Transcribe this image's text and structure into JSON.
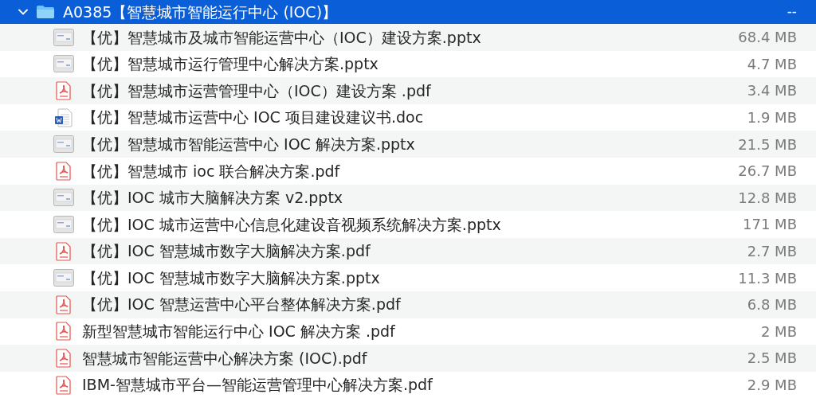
{
  "folder": {
    "name": "A0385【智慧城市智能运行中心 (IOC)】",
    "size": "--",
    "expanded": true,
    "selected": true
  },
  "files": [
    {
      "kind": "pptx",
      "name": "【优】智慧城市及城市智能运营中心（IOC）建设方案.pptx",
      "size": "68.4 MB",
      "selected": false
    },
    {
      "kind": "pptx",
      "name": "【优】智慧城市运行管理中心解决方案.pptx",
      "size": "4.7 MB",
      "selected": false
    },
    {
      "kind": "pdf",
      "name": "【优】智慧城市运营管理中心（IOC）建设方案 .pdf",
      "size": "3.4 MB",
      "selected": false
    },
    {
      "kind": "doc",
      "name": "【优】智慧城市运营中心 IOC 项目建设建议书.doc",
      "size": "1.9 MB",
      "selected": false
    },
    {
      "kind": "pptx",
      "name": "【优】智慧城市智能运营中心 IOC 解决方案.pptx",
      "size": "21.5 MB",
      "selected": false
    },
    {
      "kind": "pdf",
      "name": "【优】智慧城市 ioc 联合解决方案.pdf",
      "size": "26.7 MB",
      "selected": false
    },
    {
      "kind": "pptx",
      "name": "【优】IOC 城市大脑解决方案 v2.pptx",
      "size": "12.8 MB",
      "selected": false
    },
    {
      "kind": "pptx",
      "name": "【优】IOC 城市运营中心信息化建设音视频系统解决方案.pptx",
      "size": "171 MB",
      "selected": false
    },
    {
      "kind": "pdf",
      "name": "【优】IOC 智慧城市数字大脑解决方案.pdf",
      "size": "2.7 MB",
      "selected": false
    },
    {
      "kind": "pptx",
      "name": "【优】IOC 智慧城市数字大脑解决方案.pptx",
      "size": "11.3 MB",
      "selected": false
    },
    {
      "kind": "pdf",
      "name": "【优】IOC 智慧运营中心平台整体解决方案.pdf",
      "size": "6.8 MB",
      "selected": false
    },
    {
      "kind": "pdf",
      "name": "新型智慧城市智能运行中心 IOC 解决方案 .pdf",
      "size": "2 MB",
      "selected": false
    },
    {
      "kind": "pdf",
      "name": "智慧城市智能运营中心解决方案 (IOC).pdf",
      "size": "2.5 MB",
      "selected": false
    },
    {
      "kind": "pdf",
      "name": "IBM-智慧城市平台—智能运营管理中心解决方案.pdf",
      "size": "2.9 MB",
      "selected": false
    }
  ]
}
